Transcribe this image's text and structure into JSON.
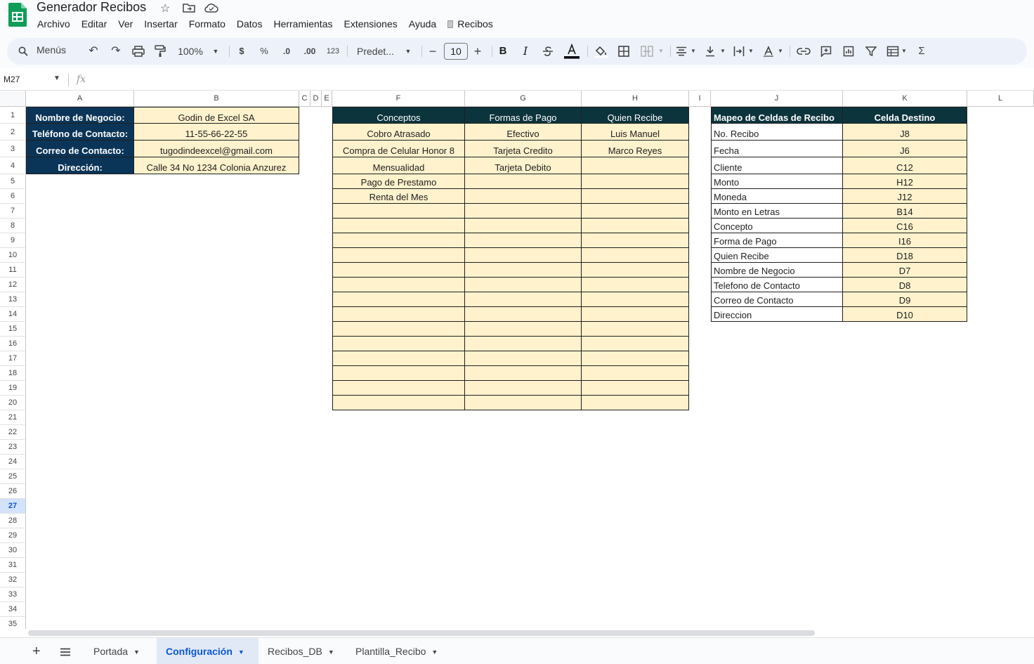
{
  "title": "Generador Recibos",
  "menu": [
    "Archivo",
    "Editar",
    "Ver",
    "Insertar",
    "Formato",
    "Datos",
    "Herramientas",
    "Extensiones",
    "Ayuda",
    "Recibos"
  ],
  "toolbar": {
    "search": "Menús",
    "zoom": "100%",
    "currency": "$",
    "percent": "%",
    "dec_decrease": ".0",
    "dec_increase": ".00",
    "number_format": "123",
    "font": "Predet...",
    "font_size": "10",
    "bold": "B",
    "italic": "I",
    "minus": "−",
    "plus": "+",
    "sigma": "Σ"
  },
  "namebox": "M27",
  "fx": "fx",
  "columns": [
    "A",
    "B",
    "C",
    "D",
    "E",
    "F",
    "G",
    "H",
    "I",
    "J",
    "K",
    "L"
  ],
  "rows": [
    "1",
    "2",
    "3",
    "4",
    "5",
    "6",
    "7",
    "8",
    "9",
    "10",
    "11",
    "12",
    "13",
    "14",
    "15",
    "16",
    "17",
    "18",
    "19",
    "20",
    "21",
    "22",
    "23",
    "24",
    "25",
    "26",
    "27",
    "28",
    "29",
    "30",
    "31",
    "32",
    "33",
    "34",
    "35"
  ],
  "active_row": "27",
  "business_table": {
    "rows": [
      {
        "label": "Nombre de Negocio:",
        "value": "Godin de Excel SA"
      },
      {
        "label": "Teléfono de Contacto:",
        "value": "11-55-66-22-55"
      },
      {
        "label": "Correo de Contacto:",
        "value": "tugodindeexcel@gmail.com"
      },
      {
        "label": "Dirección:",
        "value": "Calle 34 No 1234 Colonia Anzurez"
      }
    ]
  },
  "lists_table": {
    "headers": [
      "Conceptos",
      "Formas de Pago",
      "Quien Recibe"
    ],
    "rows": [
      [
        "Cobro Atrasado",
        "Efectivo",
        "Luis Manuel"
      ],
      [
        "Compra de Celular Honor 8",
        "Tarjeta Credito",
        "Marco Reyes"
      ],
      [
        "Mensualidad",
        "Tarjeta Debito",
        ""
      ],
      [
        "Pago de Prestamo",
        "",
        ""
      ],
      [
        "Renta del Mes",
        "",
        ""
      ],
      [
        "",
        "",
        ""
      ],
      [
        "",
        "",
        ""
      ],
      [
        "",
        "",
        ""
      ],
      [
        "",
        "",
        ""
      ],
      [
        "",
        "",
        ""
      ],
      [
        "",
        "",
        ""
      ],
      [
        "",
        "",
        ""
      ],
      [
        "",
        "",
        ""
      ],
      [
        "",
        "",
        ""
      ],
      [
        "",
        "",
        ""
      ],
      [
        "",
        "",
        ""
      ],
      [
        "",
        "",
        ""
      ],
      [
        "",
        "",
        ""
      ],
      [
        "",
        "",
        ""
      ]
    ]
  },
  "mapping_table": {
    "headers": [
      "Mapeo de Celdas de Recibo",
      "Celda Destino"
    ],
    "rows": [
      [
        "No. Recibo",
        "J8"
      ],
      [
        "Fecha",
        "J6"
      ],
      [
        "Cliente",
        "C12"
      ],
      [
        "Monto",
        "H12"
      ],
      [
        "Moneda",
        "J12"
      ],
      [
        "Monto en Letras",
        "B14"
      ],
      [
        "Concepto",
        "C16"
      ],
      [
        "Forma de Pago",
        "I16"
      ],
      [
        "Quien Recibe",
        "D18"
      ],
      [
        "Nombre de Negocio",
        "D7"
      ],
      [
        "Telefono de Contacto",
        "D8"
      ],
      [
        "Correo de Contacto",
        "D9"
      ],
      [
        "Direccion",
        "D10"
      ]
    ]
  },
  "sheets": [
    {
      "name": "Portada",
      "active": false
    },
    {
      "name": "Configuración",
      "active": true
    },
    {
      "name": "Recibos_DB",
      "active": false
    },
    {
      "name": "Plantilla_Recibo",
      "active": false
    }
  ],
  "colors": {
    "navy": "#0b3558",
    "dark_teal": "#0c343d",
    "cream": "#fff2cc",
    "white": "#ffffff"
  }
}
